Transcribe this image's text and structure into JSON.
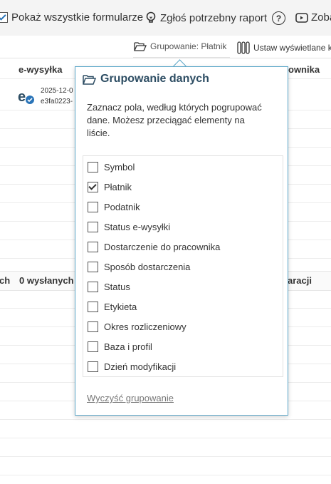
{
  "toolbar": {
    "show_all_label": "Pokaż wszystkie formularze",
    "report_label": "Zgłoś potrzebny raport",
    "help_label": "?",
    "see_label": "Zoba"
  },
  "subbar": {
    "grouping_label": "Grupowanie: Płatnik",
    "columns_label": "Ustaw wyświetlane k"
  },
  "table": {
    "col_ewysylka": "e-wysyłka",
    "col_hidden_right": "ownika",
    "ewysylka_date": "2025-12-0",
    "ewysylka_id": "e3fa0223-",
    "summary_left": "ch",
    "summary_sent": "0 wysłanych",
    "summary_right": "aracji"
  },
  "popup": {
    "title": "Grupowanie danych",
    "description": "Zaznacz pola, według których pogrupować dane. Możesz przeciągać elementy na liście.",
    "options": [
      {
        "label": "Symbol",
        "checked": false
      },
      {
        "label": "Płatnik",
        "checked": true
      },
      {
        "label": "Podatnik",
        "checked": false
      },
      {
        "label": "Status e-wysyłki",
        "checked": false
      },
      {
        "label": "Dostarczenie do pracownika",
        "checked": false
      },
      {
        "label": "Sposób dostarczenia",
        "checked": false
      },
      {
        "label": "Status",
        "checked": false
      },
      {
        "label": "Etykieta",
        "checked": false
      },
      {
        "label": "Okres rozliczeniowy",
        "checked": false
      },
      {
        "label": "Baza i profil",
        "checked": false
      },
      {
        "label": "Dzień modyfikacji",
        "checked": false
      }
    ],
    "clear_label": "Wyczyść grupowanie"
  },
  "colors": {
    "accent": "#2a74b8",
    "popup_border": "#5aa6c8",
    "title": "#2d4d63"
  }
}
